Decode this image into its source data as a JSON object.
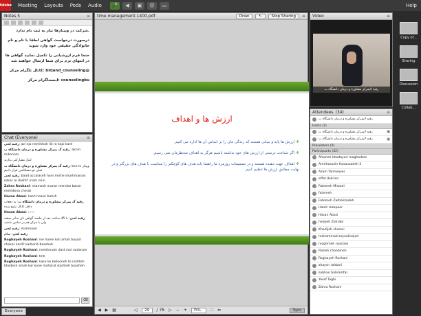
{
  "topbar": {
    "logo": "Adobe",
    "menu": [
      "Meeting",
      "Layouts",
      "Pods",
      "Audio"
    ],
    "help": "Help"
  },
  "notes": {
    "title": "Notes 5",
    "lines": [
      ".شرکت در وبینارها نیاز به ثبت نام ندارد",
      "درصورت درخواست گواهی لطفا با نام و نام خانوادگی حقیقی خود وارد شوید",
      "حتما فرم ارزشیابی را تکمیل نمایید گواهی ها در انتهای ترم برای شما ارسال خواهند شد",
      "@birjand_counseling :کانال تلگرام مرکز",
      "counselingbu :اینستاگرام مرکز"
    ]
  },
  "chat": {
    "title": "Chat (Everyone)",
    "messages": [
      {
        "user": "رقیه لحی",
        "text": "az inja nemikhah lik ro kopi kard"
      },
      {
        "user": "رقیه گ پمرکز مشاوره و درمان دانشگاه ب",
        "text": "aknm mikonam"
      },
      {
        "user": "",
        "text": "لینک مشارکتی بذارید"
      },
      {
        "user": "رقیه گ پمرکز مشاوره و درمان دانشگاه ب",
        "text": "bsn tc ویینار قبلی تو دیسکاشن قرار دادیم"
      },
      {
        "user": "رقیه لحی",
        "text": "baad az jalaseh ham mishe sharhmanasi ezkar ro dasht? inam miin"
      },
      {
        "user": "Zahra Roshani",
        "text": "shamash manor mendez baron nemidona cherat"
      },
      {
        "user": "Hasan Abasi",
        "text": "kash hozori bahsh"
      },
      {
        "user": "رقیه گ پمرکز مشاوره و درمان دانشگاه ب",
        "text": "به دفعات داخل کانال تبلیغ شده"
      },
      {
        "user": "Hasan Abasi",
        "text": "::::::"
      },
      {
        "user": "رقیه لحی",
        "text": "با 45 ساعت بعد از جلسه گواهی تان صادر میشه ولی با مرکز هم در تماس نباشید"
      },
      {
        "user": "رقیه لحی",
        "text": "mamnoon"
      },
      {
        "user": "رقیه لحی",
        "text": "سلام"
      },
      {
        "user": "Roghayeh Roshani",
        "text": "ine hame koli amali bayad chekar kard? karbordi baasheh"
      },
      {
        "user": "Roghayeh Roshani",
        "text": "nemitonam dast rasi nadaram"
      },
      {
        "user": "Roghayeh Roshani",
        "text": "tele"
      },
      {
        "user": "Roghayeh Roshani",
        "text": "kase ke betooneh to reshteh khodesh amali kar kone maharat dashteh baasheh"
      }
    ],
    "tab": "Everyone",
    "send_label": "⌫"
  },
  "presentation": {
    "filename": "time management 1400.pdf",
    "draw_label": "Draw",
    "stop_label": "Stop Sharing",
    "slide_title": "ارزش ها و اهداف",
    "bullets": [
      "ارزش ها پایه و بنیانی هستند که زندگی مان را بر اساس آن ها اداره می کنیم.",
      "اگر شناخت درستی از ارزش های خود نداشته باشیم هرگز به اهداف مدنظرمان نمی رسیم.",
      "اهداف جهت دهنده هستند و در تصمیمات روزمره ما راهنما باید هدف های کوچکتر را متناسب با هدف های بزرگتر و در نهایت مطابق ارزش ها تنظیم کنیم."
    ],
    "page": "29",
    "total": "/ 76",
    "zoom": "75%",
    "sync": "Sync"
  },
  "video": {
    "title": "Video",
    "caption": "رقیه لاپمرکز مشاوره و درمان دانشگاه ب"
  },
  "attendees": {
    "title": "Attendees",
    "count": "(34)",
    "me": "رقیه لاپمرکز مشاوره و درمان دانشگاه ب",
    "hosts_label": "Hosts (2)",
    "hosts": [
      "رقیه لاپمرکز مشاوره و درمان دانشگاه ب",
      "رقیه لاپمرکز مشاوره و درمان دانشگاه ب"
    ],
    "presenters_label": "Presenters (0)",
    "participants_label": "Participants (32)",
    "participants": [
      "Afsaneh khodayari moghadam",
      "Amirhossein Hasanzadeh 2",
      "Azam Yarmoayer",
      "effat.dalirian",
      "Fatemeh Mirzaei",
      "fatemeh",
      "Fatemeh Zarbalizadeh",
      "Haleh rezapoor",
      "Hasan Abasi",
      "hedyeh Zohrabi",
      "Khadijeh shamsi",
      "mohammad zeynalinejad",
      "moghmeh roostaei",
      "Razieh choobineh",
      "Roghayeh Roshani",
      "zhaysn rahbari",
      "sobhan bahramfar",
      "Yosef Toghi",
      "Zahra Roshani"
    ]
  },
  "dock": [
    "Copy of...",
    "Sharing",
    "Discussion",
    "Collab..."
  ]
}
